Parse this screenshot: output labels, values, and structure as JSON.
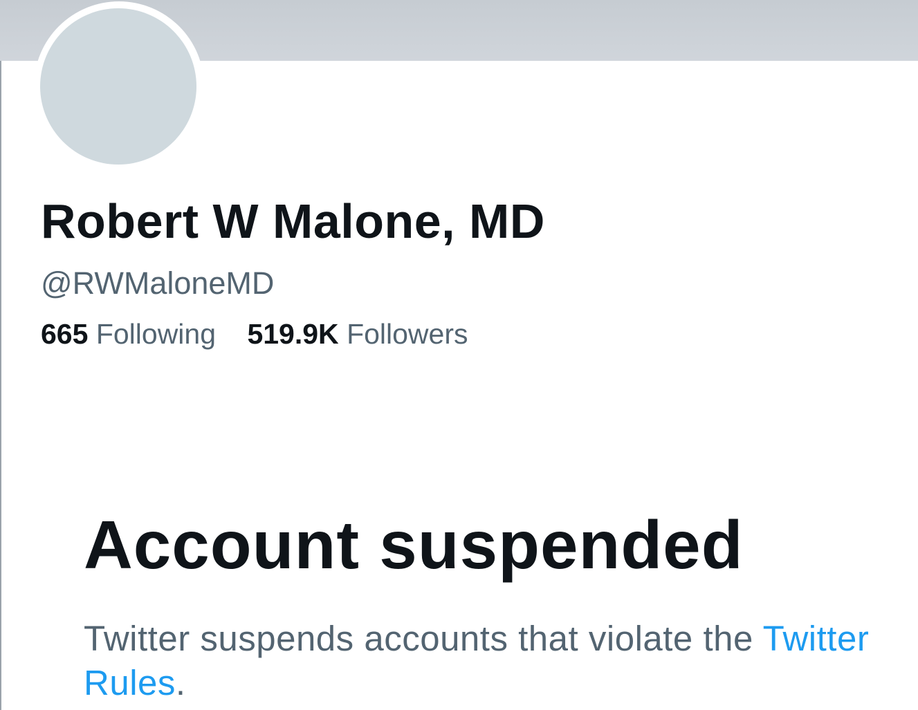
{
  "profile": {
    "display_name": "Robert W Malone, MD",
    "handle": "@RWMaloneMD",
    "following_count": "665",
    "following_label": "Following",
    "followers_count": "519.9K",
    "followers_label": "Followers"
  },
  "suspension": {
    "title": "Account suspended",
    "message": "Twitter suspends accounts that violate the",
    "link_text": "Twitter Rules",
    "trailing": "."
  },
  "colors": {
    "banner": "#cdd3d9",
    "avatar_placeholder": "#cfd9de",
    "primary_text": "#0f1419",
    "secondary_text": "#536471",
    "link": "#1d9bf0"
  }
}
